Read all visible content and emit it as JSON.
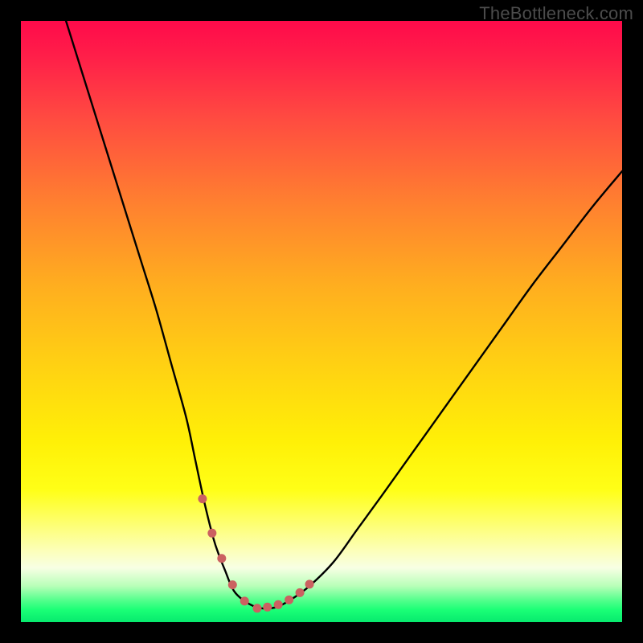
{
  "watermark": "TheBottleneck.com",
  "chart_data": {
    "type": "line",
    "title": "",
    "xlabel": "",
    "ylabel": "",
    "xlim": [
      0,
      100
    ],
    "ylim": [
      0,
      100
    ],
    "grid": false,
    "series": [
      {
        "name": "bottleneck-curve",
        "x": [
          7.5,
          10,
          12.5,
          15,
          17.5,
          20,
          22.5,
          25,
          27.5,
          29,
          30.5,
          32,
          33,
          34,
          35,
          36,
          38,
          40,
          42.5,
          45,
          48,
          52,
          56,
          60,
          65,
          70,
          75,
          80,
          85,
          90,
          95,
          100
        ],
        "values": [
          100,
          92,
          84,
          76,
          68,
          60,
          52,
          43,
          34,
          27,
          20,
          14,
          11,
          8.5,
          6,
          4.5,
          3,
          2.3,
          2.5,
          3.8,
          6,
          10,
          15.5,
          21,
          28,
          35,
          42,
          49,
          56,
          62.5,
          69,
          75
        ]
      }
    ],
    "markers": {
      "name": "highlight-points",
      "x": [
        30.2,
        31.8,
        33.4,
        35.2,
        37.2,
        39.3,
        41.0,
        42.8,
        44.6,
        46.4,
        48.0
      ],
      "values": [
        20.5,
        14.8,
        10.6,
        6.2,
        3.5,
        2.3,
        2.5,
        2.9,
        3.7,
        4.9,
        6.3
      ],
      "color": "#cb6161",
      "size": 11
    },
    "background_gradient": {
      "orientation": "vertical",
      "stops": [
        {
          "pos": 0.0,
          "color": "#ff0a4a"
        },
        {
          "pos": 0.3,
          "color": "#ff7f30"
        },
        {
          "pos": 0.58,
          "color": "#ffd312"
        },
        {
          "pos": 0.78,
          "color": "#ffff17"
        },
        {
          "pos": 0.91,
          "color": "#f7ffe4"
        },
        {
          "pos": 1.0,
          "color": "#07ea6e"
        }
      ]
    }
  }
}
